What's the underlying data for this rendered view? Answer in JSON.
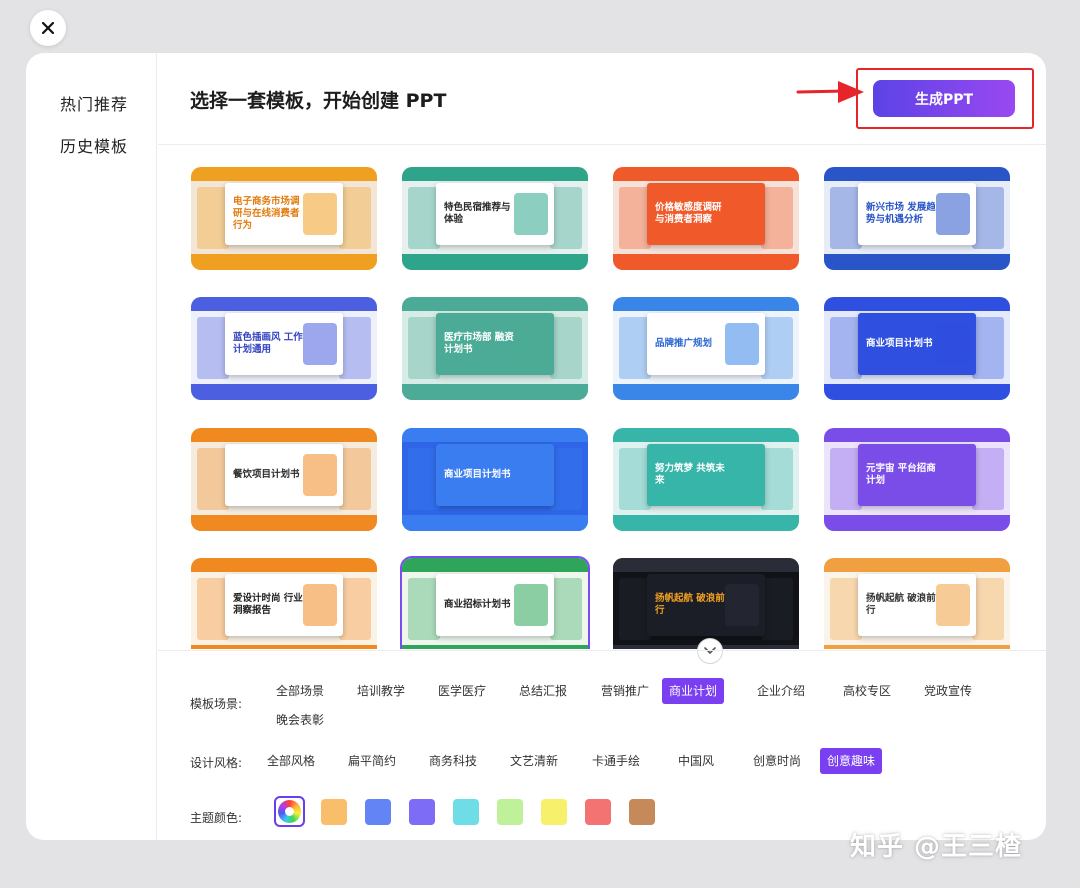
{
  "sidebar": {
    "items": [
      {
        "label": "热门推荐"
      },
      {
        "label": "历史模板"
      }
    ]
  },
  "header": {
    "title": "选择一套模板，开始创建 PPT",
    "generate_label": "生成PPT"
  },
  "templates": [
    {
      "title": "电子商务市场调研与在线消费者行为",
      "bg": "#f3e6d6",
      "accent": "#f0a020",
      "text": "#e07c10"
    },
    {
      "title": "特色民宿推荐与体验",
      "bg": "#e6f0ee",
      "accent": "#2ea58a",
      "text": "#2a2a2a"
    },
    {
      "title": "价格敏感度调研与消费者洞察",
      "bg": "#f6e2d8",
      "accent": "#f05a2a",
      "text": "#ffffff"
    },
    {
      "title": "新兴市场 发展趋势与机遇分析",
      "bg": "#e6ecf8",
      "accent": "#2a55c8",
      "text": "#2a55c8"
    },
    {
      "title": "蓝色插画风 工作计划通用",
      "bg": "#eef0fb",
      "accent": "#4b5fe0",
      "text": "#3343c0"
    },
    {
      "title": "医疗市场部 融资计划书",
      "bg": "#d7ece6",
      "accent": "#4cab96",
      "text": "#ffffff"
    },
    {
      "title": "品牌推广规划",
      "bg": "#eef4fb",
      "accent": "#3a86e8",
      "text": "#2a66d0"
    },
    {
      "title": "商业项目计划书",
      "bg": "#e4eafb",
      "accent": "#2f4fe0",
      "text": "#ffffff"
    },
    {
      "title": "餐饮项目计划书",
      "bg": "#f5ebdf",
      "accent": "#f08a20",
      "text": "#2a2a2a"
    },
    {
      "title": "商业项目计划书",
      "bg": "#2f66e8",
      "accent": "#3a7df0",
      "text": "#ffffff"
    },
    {
      "title": "努力筑梦 共筑未来",
      "bg": "#e0f2f0",
      "accent": "#37b5a8",
      "text": "#ffffff"
    },
    {
      "title": "元宇宙 平台招商计划",
      "bg": "#ece4fb",
      "accent": "#7a4de8",
      "text": "#ffffff"
    },
    {
      "title": "爱设计时尚 行业洞察报告",
      "bg": "#fbf2e6",
      "accent": "#f08a20",
      "text": "#222222"
    },
    {
      "title": "商业招标计划书",
      "bg": "#eef6ee",
      "accent": "#2ea55a",
      "text": "#222222"
    },
    {
      "title": "扬帆起航 破浪前行",
      "bg": "#111318",
      "accent": "#2a2d38",
      "text": "#f0a020"
    },
    {
      "title": "扬帆起航 破浪前行",
      "bg": "#fbf4ea",
      "accent": "#f0a040",
      "text": "#333333"
    }
  ],
  "filters": {
    "scene_label": "模板场景:",
    "scene_options": [
      "全部场景",
      "培训教学",
      "医学医疗",
      "总结汇报",
      "营销推广",
      "商业计划",
      "企业介绍",
      "高校专区",
      "党政宣传",
      "晚会表彰"
    ],
    "style_label": "设计风格:",
    "style_options": [
      "全部风格",
      "扁平简约",
      "商务科技",
      "文艺清新",
      "卡通手绘",
      "中国风",
      "创意时尚",
      "创意趣味"
    ],
    "color_label": "主题颜色:",
    "colors": [
      "#f9be6a",
      "#6384f5",
      "#7d6cf5",
      "#6fdde6",
      "#bff09a",
      "#f6f06a",
      "#f37373",
      "#c68a5a"
    ]
  },
  "watermark": "知乎 @王三楂"
}
